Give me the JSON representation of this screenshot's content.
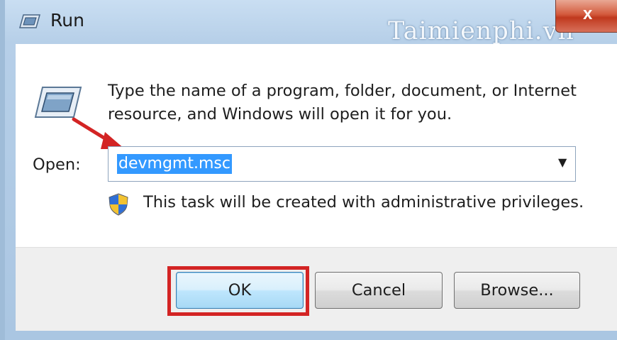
{
  "window": {
    "title": "Run",
    "close_glyph": "x",
    "watermark": "Taimienphi.vn"
  },
  "body": {
    "description": "Type the name of a program, folder, document, or Internet resource, and Windows will open it for you.",
    "open_label": "Open:",
    "open_value": "devmgmt.msc",
    "dropdown_arrow": "▼",
    "admin_notice": "This task will be created with administrative privileges."
  },
  "buttons": {
    "ok": "OK",
    "cancel": "Cancel",
    "browse": "Browse..."
  },
  "icons": {
    "title": "run-icon",
    "main": "run-icon",
    "shield": "uac-shield-icon",
    "close": "close-icon",
    "arrow": "red-arrow-annotation"
  },
  "colors": {
    "selection": "#3399ff",
    "annotation_red": "#d32424",
    "close_red": "#c0391e"
  }
}
